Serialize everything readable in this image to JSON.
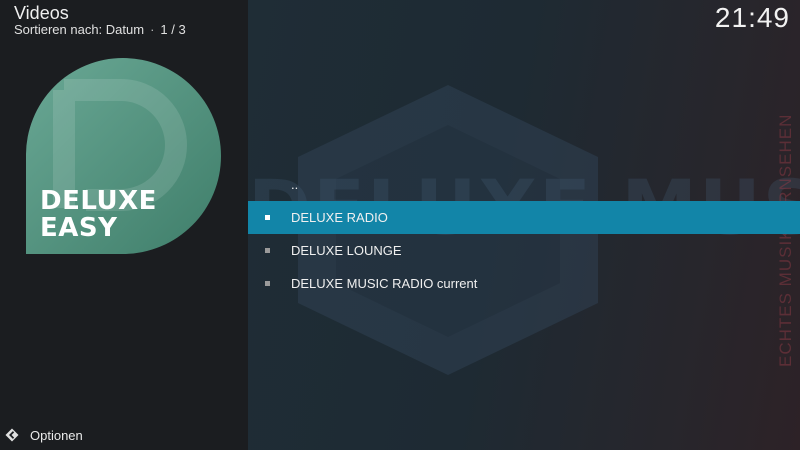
{
  "header": {
    "title": "Videos",
    "sort_label": "Sortieren nach: Datum",
    "separator": "·",
    "page_indicator": "1 / 3",
    "clock": "21:49"
  },
  "thumbnail": {
    "line1": "DELUXE",
    "line2": "EASY",
    "brand_color": "#5a9a84"
  },
  "background": {
    "watermark_text": "DELUXE MUSIC HD",
    "vertical_text": "ECHTES MUSIKFERNSEHEN"
  },
  "list": {
    "items": [
      {
        "label": "..",
        "selected": false,
        "has_bullet": false
      },
      {
        "label": "DELUXE RADIO",
        "selected": true,
        "has_bullet": true
      },
      {
        "label": "DELUXE LOUNGE",
        "selected": false,
        "has_bullet": true
      },
      {
        "label": "DELUXE MUSIC RADIO current",
        "selected": false,
        "has_bullet": true
      }
    ]
  },
  "footer": {
    "options_label": "Optionen",
    "options_icon": "options-arrow-icon"
  },
  "colors": {
    "accent": "#1285a8",
    "panel": "#1b1d20"
  }
}
